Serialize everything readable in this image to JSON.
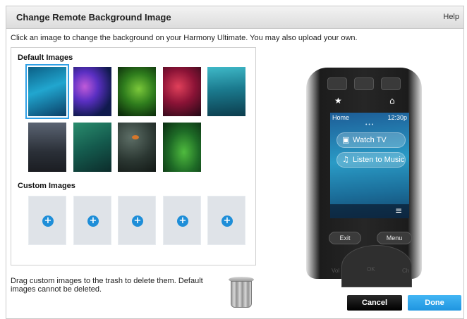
{
  "dialog": {
    "title": "Change Remote Background Image",
    "help_label": "Help"
  },
  "instructions": "Click an image to change the background on your Harmony Ultimate. You may also upload your own.",
  "default_images": {
    "label": "Default Images",
    "selected_index": 0
  },
  "custom_images": {
    "label": "Custom Images",
    "add_icon": "+"
  },
  "footer_note": "Drag custom images to the trash to delete them. Default images cannot be deleted.",
  "buttons": {
    "cancel": "Cancel",
    "done": "Done"
  },
  "remote_preview": {
    "status_left": "Home",
    "status_time": "12:30p",
    "activities": [
      "Watch TV",
      "Listen to Music"
    ],
    "keys": {
      "exit": "Exit",
      "menu": "Menu",
      "vol": "Vol",
      "ok": "OK",
      "ch": "Ch"
    }
  },
  "colors": {
    "accent": "#1f95e0",
    "selection": "#2fa0e6"
  },
  "icons": [
    "trash-icon",
    "add-icon",
    "star-icon",
    "home-icon",
    "tv-icon",
    "music-icon",
    "menu-icon"
  ]
}
